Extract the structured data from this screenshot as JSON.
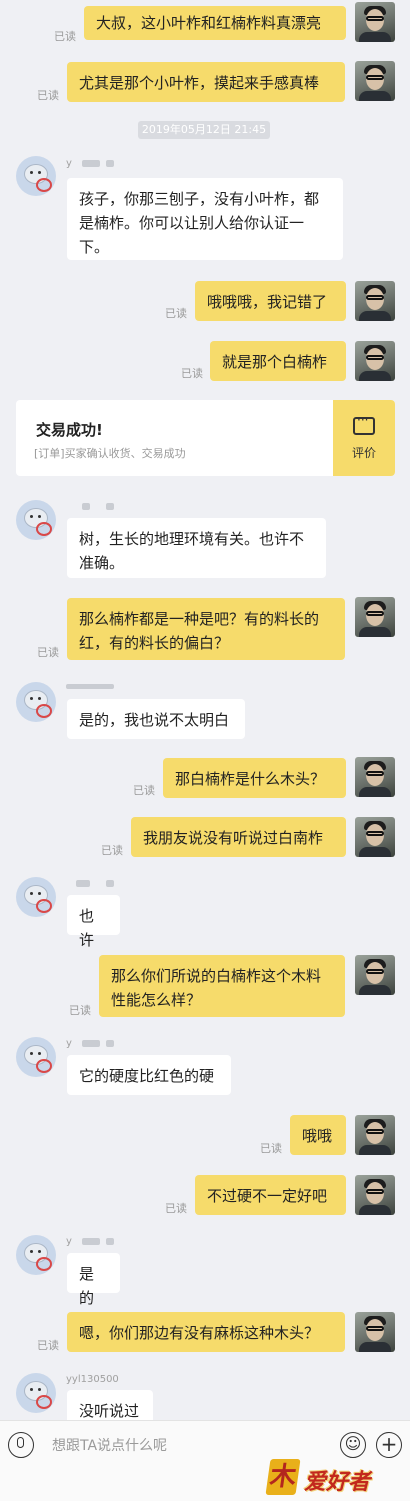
{
  "messages": [
    {
      "text": "大叔，这小叶柞和红楠柞料真漂亮",
      "read": "已读"
    },
    {
      "text": "尤其是那个小叶柞，摸起来手感真棒",
      "read": "已读"
    },
    {
      "text": "孩子，你那三刨子，没有小叶柞，都是楠柞。你可以让别人给你认证一下。",
      "nick": "y"
    },
    {
      "text": "哦哦哦，我记错了",
      "read": "已读"
    },
    {
      "text": "就是那个白楠柞",
      "read": "已读"
    },
    {
      "text": "树，生长的地理环境有关。也许不准确。"
    },
    {
      "text": "那么楠柞都是一种是吧？有的料长的红，有的料长的偏白？",
      "read": "已读"
    },
    {
      "text": "是的，我也说不太明白"
    },
    {
      "text": "那白楠柞是什么木头？",
      "read": "已读"
    },
    {
      "text": "我朋友说没有听说过白南柞",
      "read": "已读"
    },
    {
      "text": "也许"
    },
    {
      "text": "那么你们所说的白楠柞这个木料性能怎么样？",
      "read": "已读"
    },
    {
      "text": "它的硬度比红色的硬",
      "nick": "y"
    },
    {
      "text": "哦哦",
      "read": "已读"
    },
    {
      "text": "不过硬不一定好吧",
      "read": "已读"
    },
    {
      "text": "是的",
      "nick": "y"
    },
    {
      "text": "嗯，你们那边有没有麻栎这种木头？",
      "read": "已读"
    },
    {
      "text": "没听说过",
      "nick": "yyl130500"
    }
  ],
  "timestamp": "2019年05月12日 21:45",
  "order": {
    "title": "交易成功!",
    "subtitle": "[订单]买家确认收货、交易成功",
    "action": "评价",
    "action_icon": "comment-icon"
  },
  "input": {
    "placeholder": "想跟TA说点什么呢",
    "mic_icon": "microphone-icon",
    "emoji_icon": "emoji-icon",
    "plus_icon": "plus-icon"
  },
  "watermark": {
    "mark": "木",
    "text": "爱好者"
  },
  "colors": {
    "my_bubble": "#f6db6b",
    "other_bubble": "#ffffff",
    "background": "#eff0f4"
  }
}
